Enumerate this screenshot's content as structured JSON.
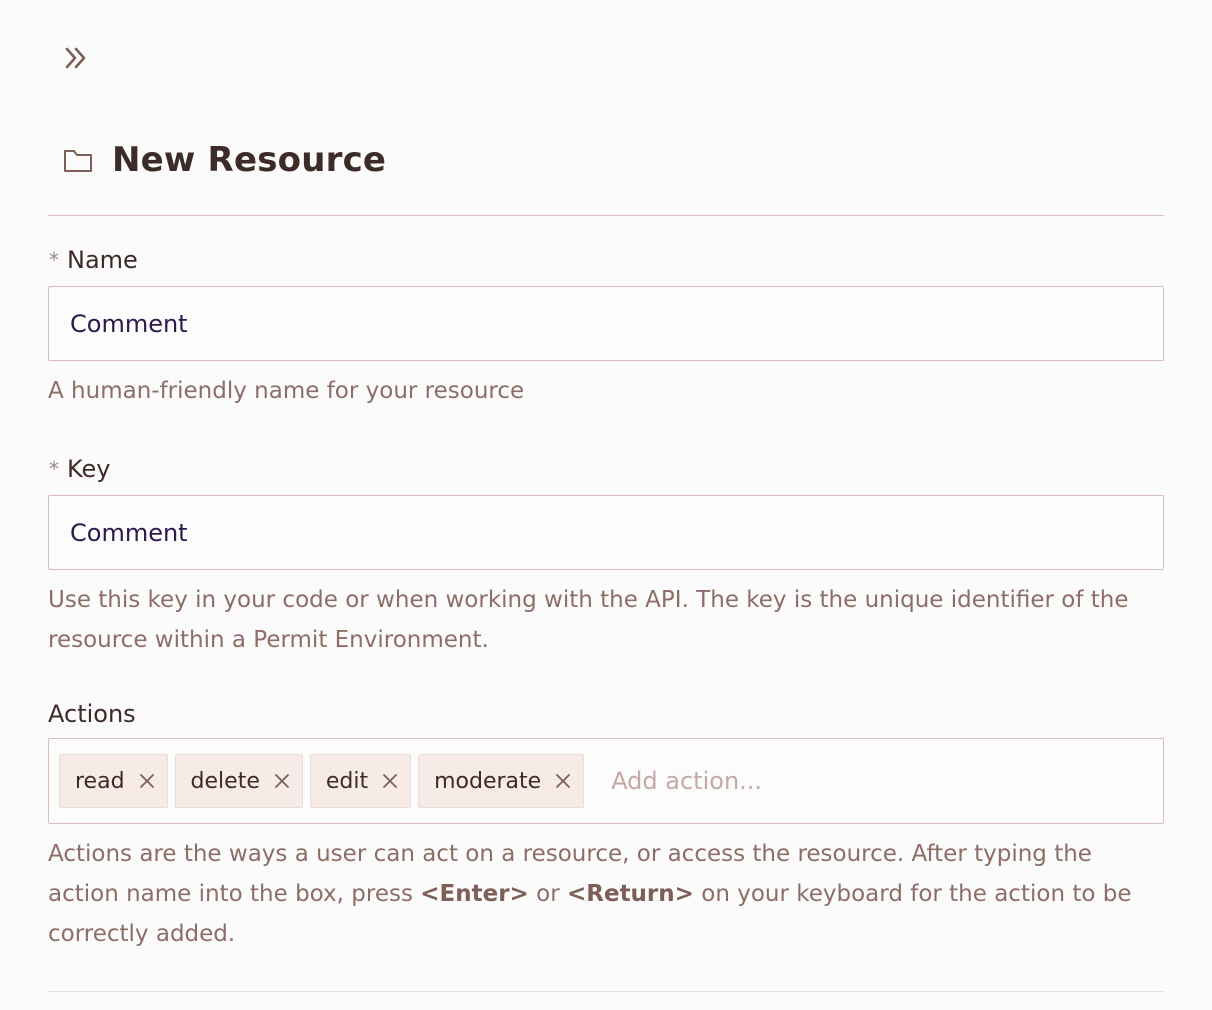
{
  "header": {
    "expand_icon": "double-chevron-right-icon",
    "folder_icon": "folder-icon",
    "title": "New Resource"
  },
  "form": {
    "name": {
      "label": "Name",
      "required_mark": "*",
      "value": "Comment",
      "help": "A human-friendly name for your resource"
    },
    "key": {
      "label": "Key",
      "required_mark": "*",
      "value": "Comment",
      "help": "Use this key in your code or when working with the API. The key is the unique identifier of the resource within a Permit Environment."
    },
    "actions": {
      "label": "Actions",
      "tags": [
        {
          "label": "read"
        },
        {
          "label": "delete"
        },
        {
          "label": "edit"
        },
        {
          "label": "moderate"
        }
      ],
      "placeholder": "Add action...",
      "help_part1": "Actions are the ways a user can act on a resource, or access the resource. After typing the action name into the box, press ",
      "help_key1": "<Enter>",
      "help_part2": " or ",
      "help_key2": "<Return>",
      "help_part3": " on your keyboard for the action to be correctly added."
    }
  },
  "colors": {
    "background": "#fcfbfb",
    "text": "#3d2b27",
    "muted": "#8d6e66",
    "border": "#d6bfba",
    "tag_bg": "#f7ebe8",
    "input_text": "#2c1a4e"
  }
}
